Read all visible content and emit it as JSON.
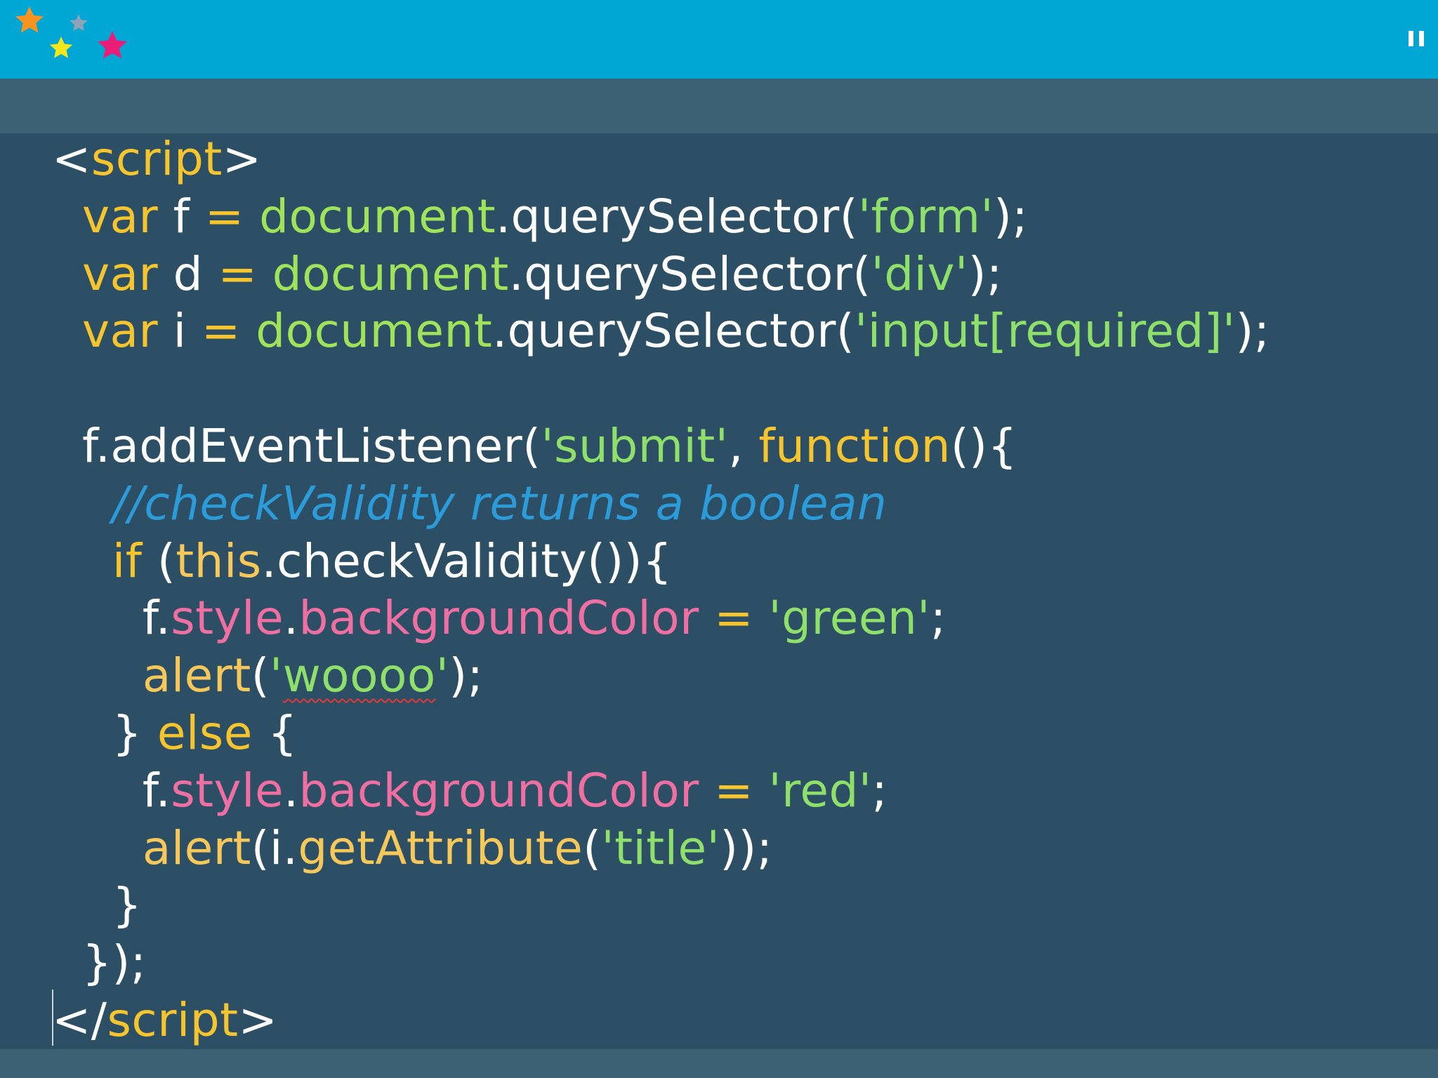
{
  "header": {
    "logo_icon": "stars-logo-icon",
    "colors": {
      "background": "#00a6d4",
      "star_orange": "#f7931e",
      "star_gray": "#8fa3b8",
      "star_yellow": "#f5e61a",
      "star_pink": "#ec1c79"
    },
    "pause_icon": "pause-icon"
  },
  "editor": {
    "colors": {
      "background": "#2d4f65",
      "bar": "#3c6175",
      "keyword": "#f6c42c",
      "string": "#8ee06a",
      "builtin": "#9fe35a",
      "property": "#f06fa2",
      "function": "#f6c85a",
      "comment": "#2c9bd9",
      "text": "#ffffff"
    },
    "lines": [
      [
        {
          "text": "<",
          "cls": "tag"
        },
        {
          "text": "script",
          "cls": "tagname"
        },
        {
          "text": ">",
          "cls": "tag"
        }
      ],
      [
        {
          "text": "  ",
          "cls": "default"
        },
        {
          "text": "var",
          "cls": "keyword"
        },
        {
          "text": " f ",
          "cls": "default"
        },
        {
          "text": "=",
          "cls": "operator"
        },
        {
          "text": " ",
          "cls": "default"
        },
        {
          "text": "document",
          "cls": "builtin"
        },
        {
          "text": ".querySelector(",
          "cls": "default"
        },
        {
          "text": "'form'",
          "cls": "string"
        },
        {
          "text": ");",
          "cls": "default"
        }
      ],
      [
        {
          "text": "  ",
          "cls": "default"
        },
        {
          "text": "var",
          "cls": "keyword"
        },
        {
          "text": " d ",
          "cls": "default"
        },
        {
          "text": "=",
          "cls": "operator"
        },
        {
          "text": " ",
          "cls": "default"
        },
        {
          "text": "document",
          "cls": "builtin"
        },
        {
          "text": ".querySelector(",
          "cls": "default"
        },
        {
          "text": "'div'",
          "cls": "string"
        },
        {
          "text": ");",
          "cls": "default"
        }
      ],
      [
        {
          "text": "  ",
          "cls": "default"
        },
        {
          "text": "var",
          "cls": "keyword"
        },
        {
          "text": " i ",
          "cls": "default"
        },
        {
          "text": "=",
          "cls": "operator"
        },
        {
          "text": " ",
          "cls": "default"
        },
        {
          "text": "document",
          "cls": "builtin"
        },
        {
          "text": ".querySelector(",
          "cls": "default"
        },
        {
          "text": "'input[required]'",
          "cls": "string"
        },
        {
          "text": ");",
          "cls": "default"
        }
      ],
      [],
      [
        {
          "text": "  f.addEventListener(",
          "cls": "default"
        },
        {
          "text": "'submit'",
          "cls": "string"
        },
        {
          "text": ", ",
          "cls": "default"
        },
        {
          "text": "function",
          "cls": "keyword"
        },
        {
          "text": "(){",
          "cls": "default"
        }
      ],
      [
        {
          "text": "    ",
          "cls": "default"
        },
        {
          "text": "//checkValidity returns a boolean",
          "cls": "comment"
        }
      ],
      [
        {
          "text": "    ",
          "cls": "default"
        },
        {
          "text": "if",
          "cls": "keyword"
        },
        {
          "text": " (",
          "cls": "default"
        },
        {
          "text": "this",
          "cls": "this"
        },
        {
          "text": ".checkValidity()){",
          "cls": "default"
        }
      ],
      [
        {
          "text": "      f.",
          "cls": "default"
        },
        {
          "text": "style",
          "cls": "property"
        },
        {
          "text": ".",
          "cls": "default"
        },
        {
          "text": "backgroundColor",
          "cls": "property"
        },
        {
          "text": " ",
          "cls": "default"
        },
        {
          "text": "=",
          "cls": "operator"
        },
        {
          "text": " ",
          "cls": "default"
        },
        {
          "text": "'green'",
          "cls": "string"
        },
        {
          "text": ";",
          "cls": "default"
        }
      ],
      [
        {
          "text": "      ",
          "cls": "default"
        },
        {
          "text": "alert",
          "cls": "function"
        },
        {
          "text": "(",
          "cls": "default"
        },
        {
          "text": "'",
          "cls": "string"
        },
        {
          "text": "woooo",
          "cls": "string squiggle"
        },
        {
          "text": "'",
          "cls": "string"
        },
        {
          "text": ");",
          "cls": "default"
        }
      ],
      [
        {
          "text": "    } ",
          "cls": "default"
        },
        {
          "text": "else",
          "cls": "keyword"
        },
        {
          "text": " {",
          "cls": "default"
        }
      ],
      [
        {
          "text": "      f.",
          "cls": "default"
        },
        {
          "text": "style",
          "cls": "property"
        },
        {
          "text": ".",
          "cls": "default"
        },
        {
          "text": "backgroundColor",
          "cls": "property"
        },
        {
          "text": " ",
          "cls": "default"
        },
        {
          "text": "=",
          "cls": "operator"
        },
        {
          "text": " ",
          "cls": "default"
        },
        {
          "text": "'red'",
          "cls": "string"
        },
        {
          "text": ";",
          "cls": "default"
        }
      ],
      [
        {
          "text": "      ",
          "cls": "default"
        },
        {
          "text": "alert",
          "cls": "function"
        },
        {
          "text": "(i.",
          "cls": "default"
        },
        {
          "text": "getAttribute",
          "cls": "function"
        },
        {
          "text": "(",
          "cls": "default"
        },
        {
          "text": "'title'",
          "cls": "string"
        },
        {
          "text": "));",
          "cls": "default"
        }
      ],
      [
        {
          "text": "    }",
          "cls": "default"
        }
      ],
      [
        {
          "text": "  });",
          "cls": "default"
        }
      ],
      [
        {
          "text": "</",
          "cls": "tag"
        },
        {
          "text": "script",
          "cls": "tagname"
        },
        {
          "text": ">",
          "cls": "tag"
        }
      ]
    ]
  }
}
